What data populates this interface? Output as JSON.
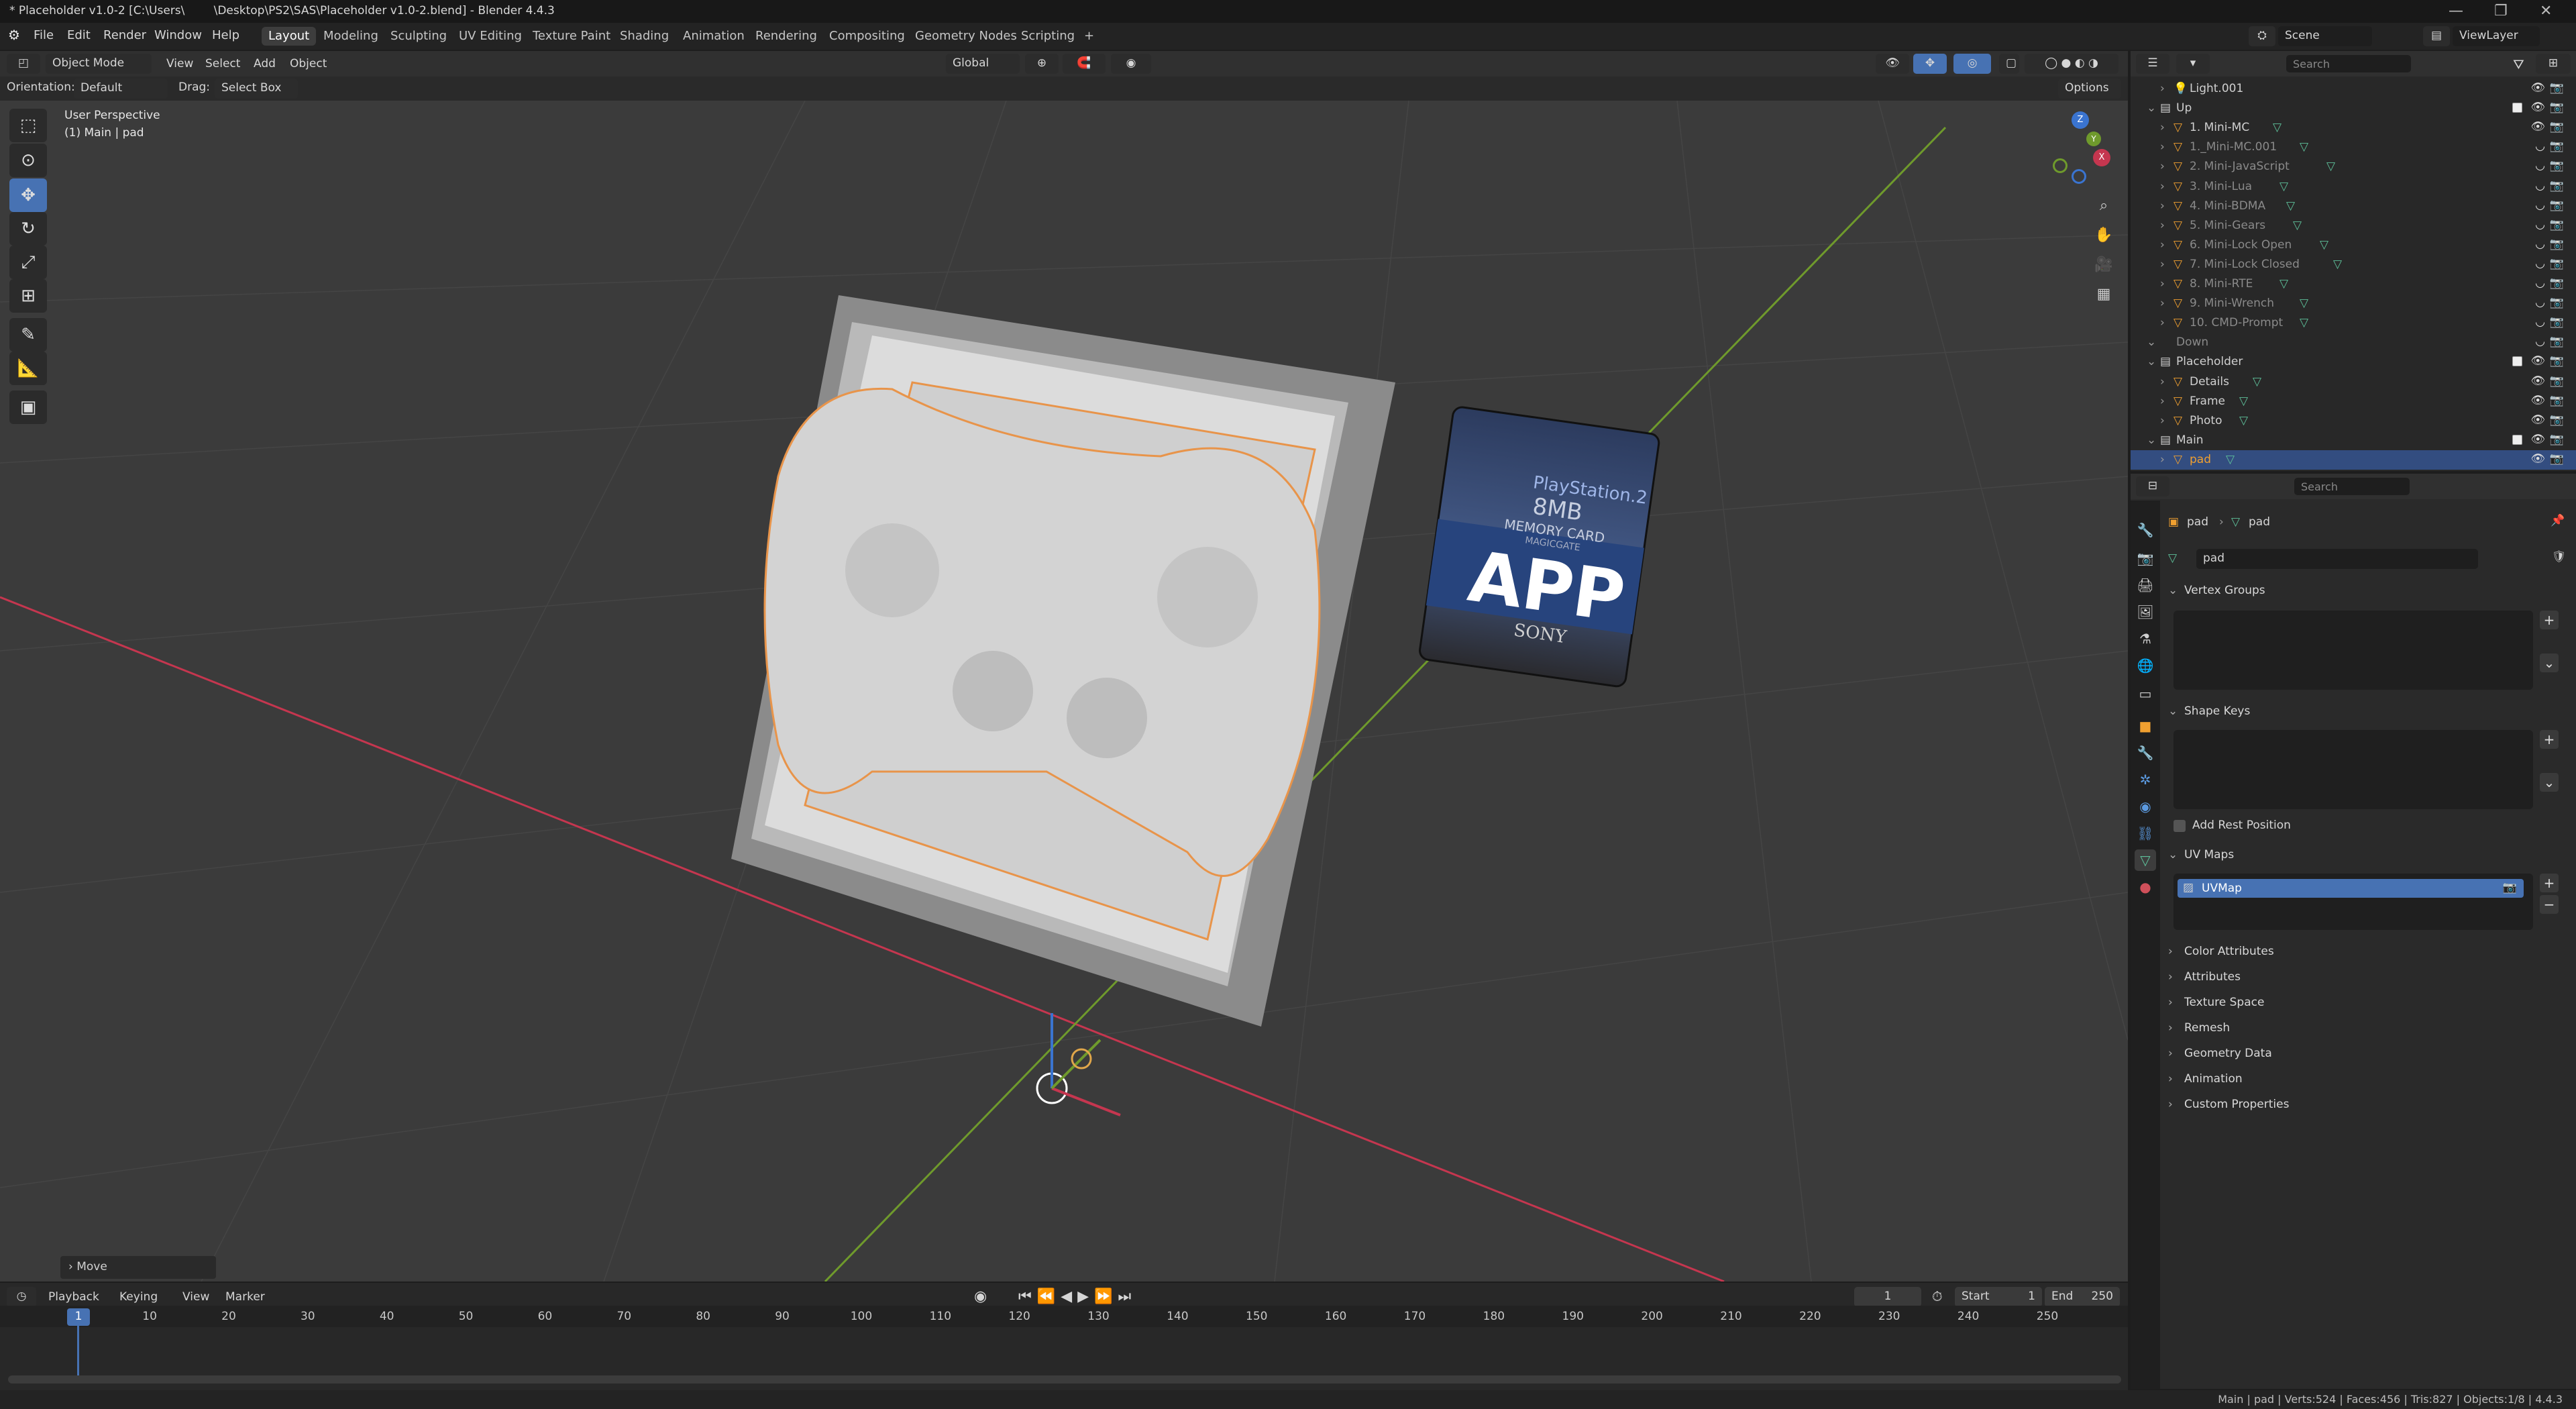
{
  "titlebar": {
    "title": "* Placeholder v1.0-2 [C:\\Users\\        \\Desktop\\PS2\\SAS\\Placeholder v1.0-2.blend] - Blender 4.4.3",
    "minimize": "—",
    "restore": "❐",
    "close": "✕"
  },
  "menus": [
    "File",
    "Edit",
    "Render",
    "Window",
    "Help"
  ],
  "workspaces": [
    "Layout",
    "Modeling",
    "Sculpting",
    "UV Editing",
    "Texture Paint",
    "Shading",
    "Animation",
    "Rendering",
    "Compositing",
    "Geometry Nodes",
    "Scripting"
  ],
  "workspace_add": "+",
  "scene": {
    "label": "Scene",
    "viewlayer": "ViewLayer"
  },
  "viewport": {
    "mode": "Object Mode",
    "menus": [
      "View",
      "Select",
      "Add",
      "Object"
    ],
    "transform": "Global",
    "orientation_label": "Orientation:",
    "orientation_value": "Default",
    "drag_label": "Drag:",
    "drag_value": "Select Box",
    "options": "Options",
    "overlay_line1": "User Perspective",
    "overlay_line2": "(1) Main | pad",
    "gizmo_axes": {
      "x": "X",
      "y": "Y",
      "z": "Z"
    },
    "last_op": "Move",
    "card": {
      "brand": "PlayStation.2",
      "size": "8MB",
      "label": "MEMORY CARD",
      "sub": "MAGICGATE",
      "app": "APP",
      "maker": "SONY"
    }
  },
  "timeline": {
    "menus": [
      "Playback",
      "Keying",
      "View",
      "Marker"
    ],
    "current_frame": "1",
    "start_label": "Start",
    "start": "1",
    "end_label": "End",
    "end": "250",
    "ticks": [
      "1",
      "10",
      "20",
      "30",
      "40",
      "50",
      "60",
      "70",
      "80",
      "90",
      "100",
      "110",
      "120",
      "130",
      "140",
      "150",
      "160",
      "170",
      "180",
      "190",
      "200",
      "210",
      "220",
      "230",
      "240",
      "250"
    ]
  },
  "statusbar": "Main | pad | Verts:524 | Faces:456 | Tris:827 | Objects:1/8 | 4.4.3",
  "outliner": {
    "search_placeholder": "Search",
    "rows": [
      {
        "label": "Light.001",
        "indent": 2,
        "kind": "light",
        "dim": false,
        "chk": false
      },
      {
        "label": "Up",
        "indent": 1,
        "kind": "collection",
        "dim": false,
        "chk": true
      },
      {
        "label": "1. Mini-MC",
        "indent": 2,
        "kind": "mesh",
        "dim": false,
        "chk": false
      },
      {
        "label": "1._Mini-MC.001",
        "indent": 2,
        "kind": "mesh",
        "dim": true,
        "chk": false
      },
      {
        "label": "2. Mini-JavaScript",
        "indent": 2,
        "kind": "mesh",
        "dim": true,
        "chk": false
      },
      {
        "label": "3. Mini-Lua",
        "indent": 2,
        "kind": "mesh",
        "dim": true,
        "chk": false
      },
      {
        "label": "4. Mini-BDMA",
        "indent": 2,
        "kind": "mesh",
        "dim": true,
        "chk": false
      },
      {
        "label": "5. Mini-Gears",
        "indent": 2,
        "kind": "mesh",
        "dim": true,
        "chk": false
      },
      {
        "label": "6. Mini-Lock Open",
        "indent": 2,
        "kind": "mesh",
        "dim": true,
        "chk": false
      },
      {
        "label": "7. Mini-Lock Closed",
        "indent": 2,
        "kind": "mesh",
        "dim": true,
        "chk": false
      },
      {
        "label": "8. Mini-RTE",
        "indent": 2,
        "kind": "mesh",
        "dim": true,
        "chk": false
      },
      {
        "label": "9. Mini-Wrench",
        "indent": 2,
        "kind": "mesh",
        "dim": true,
        "chk": false
      },
      {
        "label": "10. CMD-Prompt",
        "indent": 2,
        "kind": "mesh",
        "dim": true,
        "chk": false
      },
      {
        "label": "Down",
        "indent": 1,
        "kind": "none",
        "dim": true,
        "chk": false
      },
      {
        "label": "Placeholder",
        "indent": 1,
        "kind": "collection",
        "dim": false,
        "chk": true
      },
      {
        "label": "Details",
        "indent": 2,
        "kind": "mesh",
        "dim": false,
        "chk": false
      },
      {
        "label": "Frame",
        "indent": 2,
        "kind": "mesh",
        "dim": false,
        "chk": false
      },
      {
        "label": "Photo",
        "indent": 2,
        "kind": "mesh",
        "dim": false,
        "chk": false
      },
      {
        "label": "Main",
        "indent": 1,
        "kind": "collection",
        "dim": false,
        "chk": true
      },
      {
        "label": "pad",
        "indent": 2,
        "kind": "mesh",
        "dim": false,
        "chk": false,
        "selected": true
      }
    ]
  },
  "properties": {
    "search_placeholder": "Search",
    "breadcrumb": [
      "pad",
      "pad"
    ],
    "data_name": "pad",
    "panels": {
      "vertex_groups": "Vertex Groups",
      "shape_keys": "Shape Keys",
      "add_rest_position": "Add Rest Position",
      "uv_maps": "UV Maps",
      "uv_item": "UVMap"
    },
    "collapsed": [
      "Color Attributes",
      "Attributes",
      "Texture Space",
      "Remesh",
      "Geometry Data",
      "Animation",
      "Custom Properties"
    ]
  },
  "colors": {
    "accent": "#4772b3",
    "selected_row": "#334d80",
    "x_axis": "#c5364f",
    "y_axis": "#6f9a2c",
    "z_axis": "#3a74d0",
    "selection_outline": "#e8944a",
    "mesh_icon": "#f0a030",
    "data_icon": "#5ec09a"
  }
}
